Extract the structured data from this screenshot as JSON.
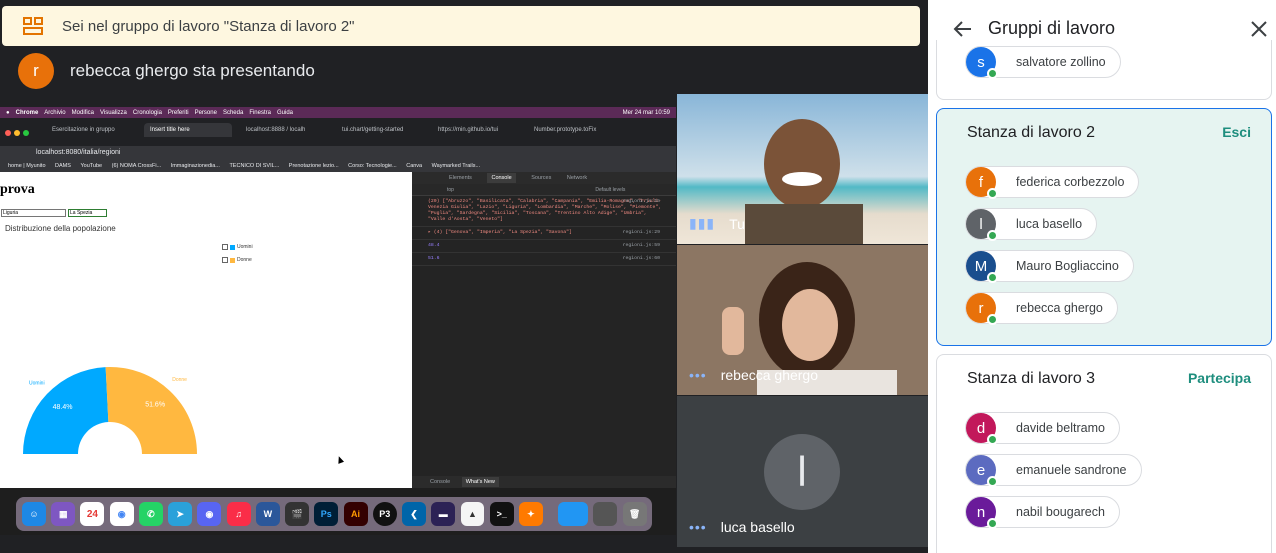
{
  "banner": {
    "text": "Sei nel gruppo di lavoro \"Stanza di lavoro 2\"",
    "icon": "breakout-rooms-icon"
  },
  "presenter": {
    "initial": "r",
    "text": "rebecca ghergo sta presentando"
  },
  "shared_screen": {
    "menubar": [
      "Chrome",
      "Archivio",
      "Modifica",
      "Visualizza",
      "Cronologia",
      "Preferiti",
      "Persone",
      "Scheda",
      "Finestra",
      "Guida"
    ],
    "clock": "Mer 24 mar  10:59",
    "tabs": [
      "Esercitazione in gruppo",
      "Insert title here",
      "localhost:8888 / localh",
      "tui.chart/getting-started",
      "https://min.github.io/tui",
      "Number.prototype.toFix"
    ],
    "url": "localhost:8080/italia/regioni",
    "bookmarks": [
      "home | Myunito",
      "DAMS",
      "YouTube",
      "(6) NOMA CrossFi...",
      "Immaginazionedia...",
      "TECNICO DI SVIL...",
      "Prenotazione lezio...",
      "Corso: Tecnologie...",
      "Canva",
      "Waymarked Trails..."
    ],
    "page": {
      "title": "prova",
      "select1": "Liguria",
      "select2": "La Spezia",
      "chart_title": "Distribuzione della popolazione",
      "legend": [
        "Uomini",
        "Donne"
      ]
    },
    "devtools": {
      "tabs": [
        "Elements",
        "Console",
        "Sources",
        "Network"
      ],
      "filter": "top",
      "levels": "Default levels",
      "logs": [
        {
          "text": "(20) [\"Abruzzo\", \"Basilicata\", \"Calabria\", \"Campania\", \"Emilia-Romagna\", \"Friuli-Venezia Giulia\", \"Lazio\", \"Liguria\", \"Lombardia\", \"Marche\", \"Molise\", \"Piemonte\", \"Puglia\", \"Sardegna\", \"Sicilia\", \"Toscana\", \"Trentino Alto Adige\", \"Umbria\", \"Valle d'Aosta\", \"Veneto\"]",
          "src": "regioni.js:15"
        },
        {
          "text": "▸ (4) [\"Genova\", \"Imperia\", \"La Spezia\", \"Savona\"]",
          "src": "regioni.js:29"
        },
        {
          "text": "48.4",
          "src": "regioni.js:59"
        },
        {
          "text": "51.6",
          "src": "regioni.js:60"
        }
      ],
      "bottom_tabs": [
        "Console",
        "What's New"
      ]
    },
    "dock": [
      "Finder",
      "Launchpad",
      "Calendar 24",
      "Chrome",
      "WhatsApp",
      "Telegram",
      "Discord",
      "Music",
      "Word",
      "Final Cut",
      "Ps",
      "Ai",
      "P3",
      "VS Code",
      "Eclipse",
      "TablePlus",
      "Terminal",
      "Sublime",
      "Folder",
      "Preview",
      "Trash"
    ]
  },
  "chart_data": {
    "type": "pie",
    "title": "Distribuzione della popolazione",
    "categories": [
      "Uomini",
      "Donne"
    ],
    "values": [
      48.4,
      51.6
    ],
    "value_labels": [
      "48.4%",
      "51.6%"
    ],
    "colors": [
      "#00a9ff",
      "#ffb840"
    ],
    "shape": "semi-donut",
    "legend": "top-right"
  },
  "tiles": [
    {
      "name": "Tu",
      "indicator": "audio-active-icon"
    },
    {
      "name": "rebecca ghergo",
      "indicator": "more-dots-icon"
    },
    {
      "name": "luca basello",
      "initial": "l",
      "indicator": "more-dots-icon"
    }
  ],
  "panel": {
    "title": "Gruppi di lavoro",
    "prev_member": {
      "name": "salvatore zollino",
      "initial": "s",
      "color": "#1a73e8"
    },
    "groups": [
      {
        "title": "Stanza di lavoro 2",
        "action": "Esci",
        "members": [
          {
            "name": "federica corbezzolo",
            "initial": "f",
            "color": "#e8710a"
          },
          {
            "name": "luca basello",
            "initial": "l",
            "color": "#5f6368"
          },
          {
            "name": "Mauro Bogliaccino",
            "initial": "M",
            "color": "#1a4e8e"
          },
          {
            "name": "rebecca ghergo",
            "initial": "r",
            "color": "#e8710a"
          }
        ]
      },
      {
        "title": "Stanza di lavoro 3",
        "action": "Partecipa",
        "members": [
          {
            "name": "davide beltramo",
            "initial": "d",
            "color": "#c2185b"
          },
          {
            "name": "emanuele sandrone",
            "initial": "e",
            "color": "#5c6bc0"
          },
          {
            "name": "nabil bougarech",
            "initial": "n",
            "color": "#6a1b9a"
          }
        ]
      }
    ]
  }
}
